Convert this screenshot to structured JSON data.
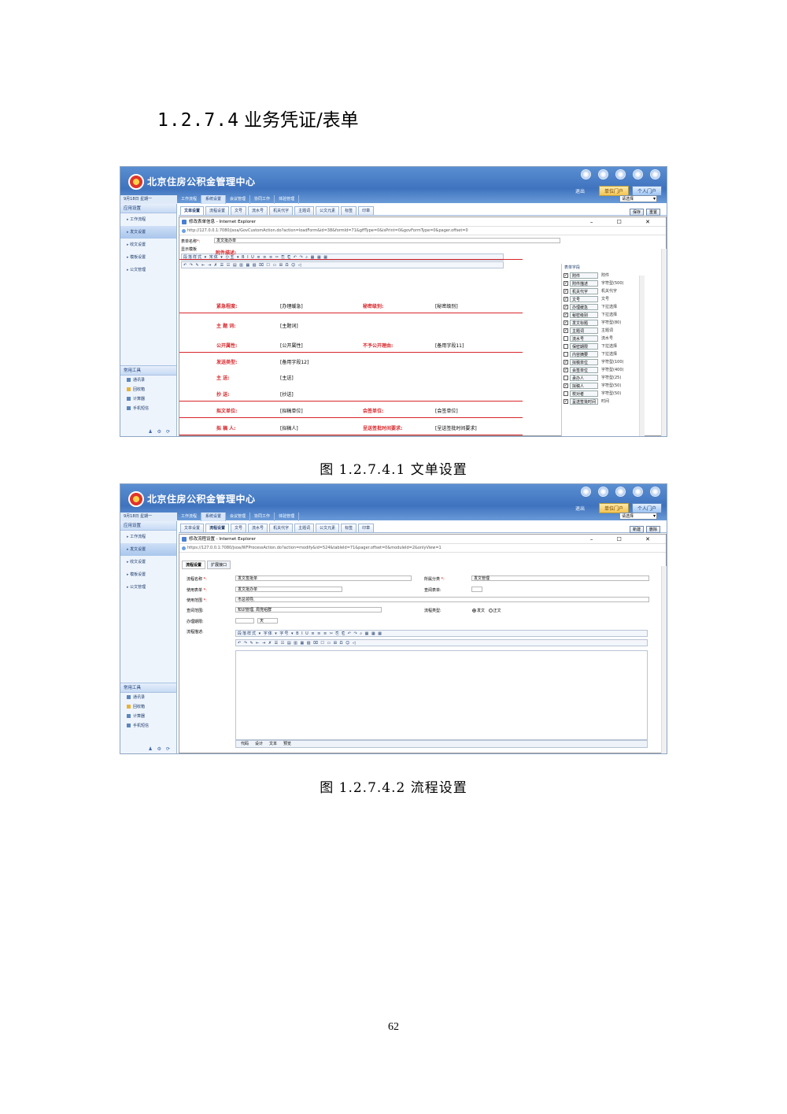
{
  "heading": {
    "number": "1.2.7.4",
    "title": "业务凭证/表单"
  },
  "app": {
    "brand": "北京住房公积金管理中心",
    "exit": "退出",
    "unit_portal": "单位门户",
    "personal_portal": "个人门户",
    "select_placeholder": "请选择",
    "menus": [
      "工作流程",
      "系统设置",
      "会议管理",
      "协同工作",
      "体验管理"
    ]
  },
  "shot1": {
    "date": "9月18日 星期一",
    "side_head": "应用设置",
    "side_items": [
      "工作流程",
      "发文设置",
      "收文设置",
      "模板设置",
      "公文管理"
    ],
    "tools_head": "常用工具",
    "tools": [
      "通讯录",
      "回收箱",
      "计算器",
      "手机短信"
    ],
    "tabs": [
      "文单设置",
      "流程设置",
      "文号",
      "流水号",
      "机关代字",
      "主题词",
      "公文元素",
      "标签",
      "印章"
    ],
    "actions": [
      "保存",
      "重置"
    ],
    "dialog_title": "修改表单信息 - Internet Explorer",
    "url": "http://127.0.0.1:7080/jsoa/GovCustomAction.do?action=loadForm&id=38&formId=71&gffType=0&isPrint=0&govFormType=0&pager.offset=0",
    "form_name_label": "表单名称",
    "form_name_value": "发文批办单",
    "display_mode_label": "显示模板",
    "editor_toolbar": "段落样式 ▾ 宋体 ▾ 小五 ▾  B I U  ≡ ≡ ≡  ✂ ⎘ ⎗  ↶ ↷  ⌕  ▦ ▦ ▦",
    "form_rows": [
      {
        "l1": "紧急程度:",
        "v1": "[办理缓急]",
        "l2": "秘密级别:",
        "v2": "[秘密级别]"
      },
      {
        "l1": "主 题 词:",
        "v1": "[主题词]",
        "l2": "",
        "v2": ""
      },
      {
        "l1": "公开属性:",
        "v1": "[公开属性]",
        "l2": "不予公开理由:",
        "v2": "[备用字段11]"
      },
      {
        "l1": "发送类型:",
        "v1": "[备用字段12]",
        "l2": "",
        "v2": ""
      },
      {
        "l1": "主    送:",
        "v1": "[主送]",
        "l2": "",
        "v2": ""
      },
      {
        "l1": "抄    送:",
        "v1": "[抄送]",
        "l2": "",
        "v2": ""
      },
      {
        "l1": "拟文单位:",
        "v1": "[拟稿单位]",
        "l2": "会签单位:",
        "v2": "[会签单位]"
      },
      {
        "l1": "拟 稿 人:",
        "v1": "[拟稿人]",
        "l2": "呈送签批时间要求:",
        "v2": "[呈送签批时间要求]"
      }
    ],
    "field_panel_head": "表单字段",
    "fields": [
      {
        "name": "附件",
        "type": "附件",
        "checked": true
      },
      {
        "name": "附件描述",
        "type": "字符型(500)",
        "checked": true
      },
      {
        "name": "机关代字",
        "type": "机关代字",
        "checked": true
      },
      {
        "name": "文号",
        "type": "文号",
        "checked": true
      },
      {
        "name": "办理缓急",
        "type": "下拉选择",
        "checked": true
      },
      {
        "name": "秘密级别",
        "type": "下拉选择",
        "checked": true
      },
      {
        "name": "发文标题",
        "type": "字符型(80)",
        "checked": true
      },
      {
        "name": "主题词",
        "type": "主题词",
        "checked": true
      },
      {
        "name": "流水号",
        "type": "流水号",
        "checked": false
      },
      {
        "name": "保密期限",
        "type": "下拉选择",
        "checked": false
      },
      {
        "name": "内容摘要",
        "type": "下拉选择",
        "checked": false
      },
      {
        "name": "拟稿单位",
        "type": "字符型(100)",
        "checked": true
      },
      {
        "name": "会签单位",
        "type": "字符型(400)",
        "checked": true
      },
      {
        "name": "承办人",
        "type": "字符型(25)",
        "checked": false
      },
      {
        "name": "拟稿人",
        "type": "字符型(50)",
        "checked": true
      },
      {
        "name": "校对者",
        "type": "字符型(50)",
        "checked": false
      },
      {
        "name": "呈送签批时间",
        "type": "时间",
        "checked": true
      }
    ]
  },
  "caption1": "图 1.2.7.4.1 文单设置",
  "shot2": {
    "date": "9月18日 星期一",
    "side_head": "应用设置",
    "side_items": [
      "工作流程",
      "发文设置",
      "收文设置",
      "模板设置",
      "公文管理"
    ],
    "tools_head": "常用工具",
    "tools": [
      "通讯录",
      "回收箱",
      "计算器",
      "手机短信"
    ],
    "tabs": [
      "文单设置",
      "流程设置",
      "文号",
      "流水号",
      "机关代字",
      "主题词",
      "公文元素",
      "标签",
      "印章"
    ],
    "actions": [
      "新建",
      "删除"
    ],
    "dialog_title": "修改流程设置 - Internet Explorer",
    "url": "https://127.0.0.1:7080/jsoa/WFProcessAction.do?action=modify&id=524&tableId=71&pager.offset=0&moduleId=2&onlyView=1",
    "subtabs": [
      "流程设置",
      "扩展接口"
    ],
    "labels": {
      "process_name": "流程名称",
      "category": "所属分类",
      "form": "使用表单",
      "related_form": "查阅表单",
      "scope": "使用范围",
      "query_scope": "查阅范围",
      "process_type": "流程类型",
      "deadline": "办理期限",
      "description": "流程描述"
    },
    "values": {
      "process_name": "发文签批单",
      "category": "发文管理",
      "form": "发文批办单",
      "scope": "市总领导,",
      "query_scope": "知识管理, 局党组群",
      "deadline_unit": "天",
      "type_option1": "发文",
      "type_option2": "正文"
    },
    "editor_toolbar": "段落样式 ▾ 字体 ▾ 字号 ▾  B I U  ≡ ≡ ≡  ✂ ⎘ ⎗  ↶ ↷  ⌕  ▦ ▦ ▦",
    "editor_modes": [
      "代码",
      "设计",
      "文本",
      "预览"
    ]
  },
  "caption2": "图 1.2.7.4.2 流程设置",
  "page_number": "62"
}
